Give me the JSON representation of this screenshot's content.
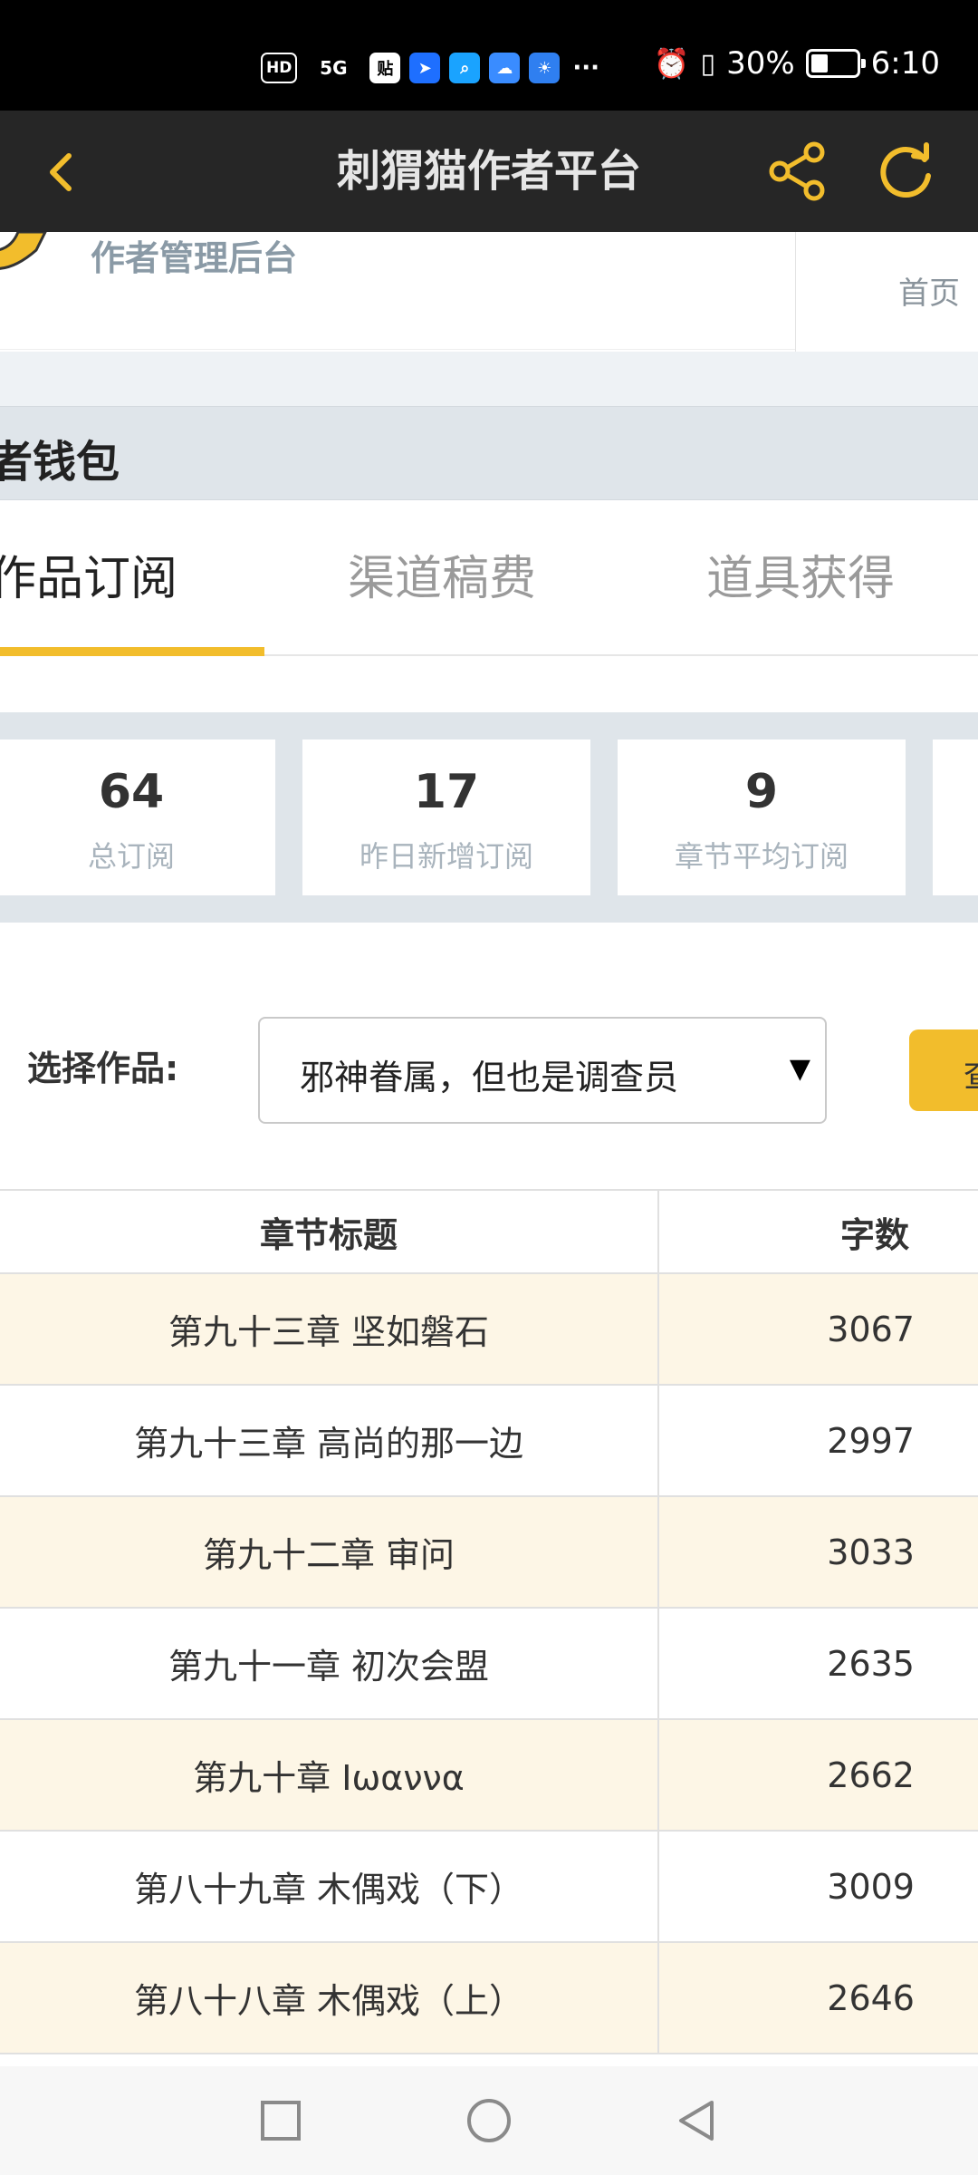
{
  "status_bar": {
    "hd": "HD",
    "signal": "5G",
    "battery": "30%",
    "time": "6:10",
    "more": "···"
  },
  "header": {
    "title": "刺猬猫作者平台"
  },
  "subheader": {
    "title": "作者管理后台",
    "home": "首页"
  },
  "section": {
    "title": "者钱包"
  },
  "tabs": [
    {
      "label": "作品订阅",
      "active": true
    },
    {
      "label": "渠道稿费",
      "active": false
    },
    {
      "label": "道具获得",
      "active": false
    }
  ],
  "stats": [
    {
      "value": "64",
      "label": "总订阅"
    },
    {
      "value": "17",
      "label": "昨日新增订阅"
    },
    {
      "value": "9",
      "label": "章节平均订阅"
    }
  ],
  "filter": {
    "label": "选择作品:",
    "selected": "邪神眷属，但也是调查员",
    "query_button": "查"
  },
  "table": {
    "headers": {
      "title": "章节标题",
      "words": "字数"
    },
    "rows": [
      {
        "title": "第九十三章 坚如磐石",
        "words": "3067"
      },
      {
        "title": "第九十三章 高尚的那一边",
        "words": "2997"
      },
      {
        "title": "第九十二章 审问",
        "words": "3033"
      },
      {
        "title": "第九十一章 初次会盟",
        "words": "2635"
      },
      {
        "title": "第九十章 Iωαννα",
        "words": "2662"
      },
      {
        "title": "第八十九章 木偶戏（下）",
        "words": "3009"
      },
      {
        "title": "第八十八章 木偶戏（上）",
        "words": "2646"
      }
    ]
  },
  "colors": {
    "accent": "#f2bd2c",
    "header_bg": "#262626",
    "row_alt": "#fdf6e6"
  }
}
